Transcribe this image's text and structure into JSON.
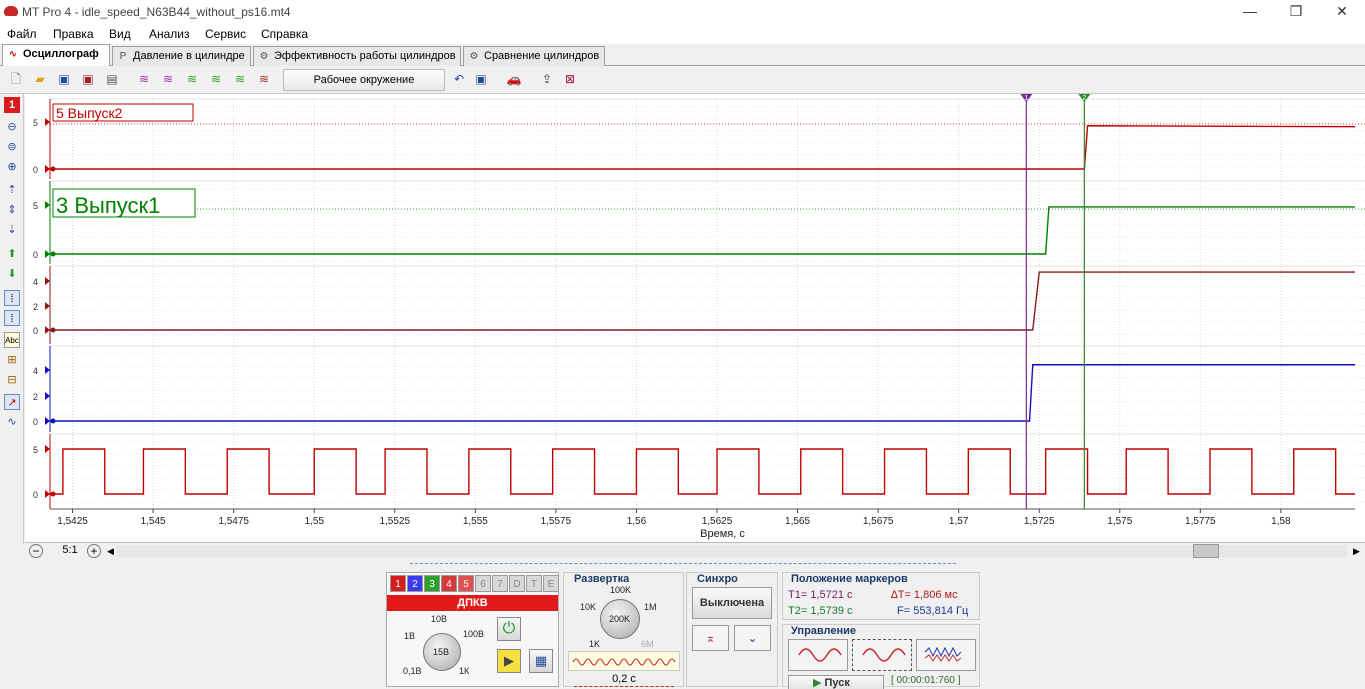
{
  "window": {
    "title": "MT Pro 4 - idle_speed_N63B44_without_ps16.mt4",
    "minimize": "—",
    "restore": "❐",
    "close": "✕"
  },
  "menu": [
    "Файл",
    "Правка",
    "Вид",
    "Анализ",
    "Сервис",
    "Справка"
  ],
  "tabs": [
    {
      "label": "Осциллограф",
      "active": true
    },
    {
      "label": "Давление в цилиндре",
      "active": false
    },
    {
      "label": "Эффективность работы цилиндров",
      "active": false
    },
    {
      "label": "Сравнение цилиндров",
      "active": false
    }
  ],
  "toolbar": {
    "environment": "Рабочее окружение"
  },
  "left_tools": {
    "channel_num": "1",
    "abc": "Abc"
  },
  "plot": {
    "xlabel": "Время, с",
    "x_ticks": [
      "1,5425",
      "1,545",
      "1,5475",
      "1,55",
      "1,5525",
      "1,555",
      "1,5575",
      "1,56",
      "1,5625",
      "1,565",
      "1,5675",
      "1,57",
      "1,5725",
      "1,575",
      "1,5775",
      "1,58"
    ],
    "x_tick_values": [
      1.5425,
      1.545,
      1.5475,
      1.55,
      1.5525,
      1.555,
      1.5575,
      1.56,
      1.5625,
      1.565,
      1.5675,
      1.57,
      1.5725,
      1.575,
      1.5775,
      1.58
    ],
    "xlim": [
      1.5418,
      1.5823
    ],
    "channels": [
      {
        "label": "5 Выпуск2",
        "color": "#c00000",
        "yticks": [
          "5",
          "0"
        ]
      },
      {
        "label": "3 Выпуск1",
        "color": "#008000",
        "yticks": [
          "5",
          "0"
        ]
      },
      {
        "label": "",
        "color": "#8b1a1a",
        "yticks": [
          "4",
          "2",
          "0"
        ]
      },
      {
        "label": "",
        "color": "#1010c0",
        "yticks": [
          "4",
          "2",
          "0"
        ]
      },
      {
        "label": "",
        "color": "#c00000",
        "yticks": [
          "5",
          "0"
        ]
      }
    ],
    "markers": [
      {
        "name": "T1",
        "time": 1.5721,
        "color": "#7a2a8a",
        "label": "1"
      },
      {
        "name": "T2",
        "time": 1.5739,
        "color": "#2a8a2a",
        "label": "2"
      }
    ]
  },
  "chart_data": {
    "type": "line",
    "xlabel": "Время, с",
    "xlim": [
      1.5418,
      1.5823
    ],
    "series": [
      {
        "name": "5 Выпуск2",
        "x": [
          1.5418,
          1.5739,
          1.574,
          1.5823
        ],
        "values": [
          0,
          0,
          4.7,
          4.6
        ]
      },
      {
        "name": "3 Выпуск1",
        "x": [
          1.5418,
          1.5727,
          1.5728,
          1.5823
        ],
        "values": [
          0,
          0,
          4.8,
          4.8
        ]
      },
      {
        "x": [
          1.5418,
          1.5723,
          1.5725,
          1.5823
        ],
        "values": [
          0,
          0,
          4.6,
          4.6
        ]
      },
      {
        "x": [
          1.5418,
          1.5722,
          1.5723,
          1.5823
        ],
        "values": [
          0,
          0,
          4.5,
          4.5
        ]
      },
      {
        "x_high_intervals": [
          [
            1.5422,
            1.5435
          ],
          [
            1.5447,
            1.546
          ],
          [
            1.5473,
            1.5486
          ],
          [
            1.55,
            1.5513
          ],
          [
            1.5522,
            1.5535
          ],
          [
            1.5548,
            1.5561
          ],
          [
            1.5574,
            1.5587
          ],
          [
            1.56,
            1.5613
          ],
          [
            1.5625,
            1.5638
          ],
          [
            1.5651,
            1.5664
          ],
          [
            1.5677,
            1.569
          ],
          [
            1.5703,
            1.5716
          ],
          [
            1.5727,
            1.574
          ],
          [
            1.5752,
            1.5765
          ],
          [
            1.5778,
            1.5791
          ],
          [
            1.5804,
            1.5817
          ]
        ],
        "high": 5,
        "low": 0
      }
    ]
  },
  "bottom_bar": {
    "zoom": "5:1"
  },
  "channel_panel": {
    "buttons": [
      "1",
      "2",
      "3",
      "4",
      "5",
      "6",
      "7",
      "D",
      "T",
      "E"
    ],
    "colors": [
      "#d81b1b",
      "#3a3af0",
      "#2ea02e",
      "#d83a3a",
      "#e05050",
      "#d8d8d8",
      "#d8d8d8",
      "#d8d8d8",
      "#d8d8d8",
      "#d8d8d8"
    ],
    "name": "ДПКВ",
    "knob_labels": [
      "10В",
      "1В",
      "100В",
      "0,1В",
      "1К"
    ],
    "knob_value": "15В"
  },
  "sweep": {
    "title": "Развертка",
    "labels": [
      "100K",
      "10K",
      "1M",
      "1K",
      "6M"
    ],
    "knob_value": "200K",
    "time": "0,2 с"
  },
  "sync": {
    "title": "Синхро",
    "state": "Выключена"
  },
  "markers_pos": {
    "title": "Положение маркеров",
    "t1": "T1= 1,5721 с",
    "t2": "T2= 1,5739 с",
    "dt": "∆T= 1,806 мс",
    "f": "F= 553,814 Гц"
  },
  "control": {
    "title": "Управление",
    "start_btn": "Пуск",
    "timer": "[ 00:00:01:760 ]"
  }
}
